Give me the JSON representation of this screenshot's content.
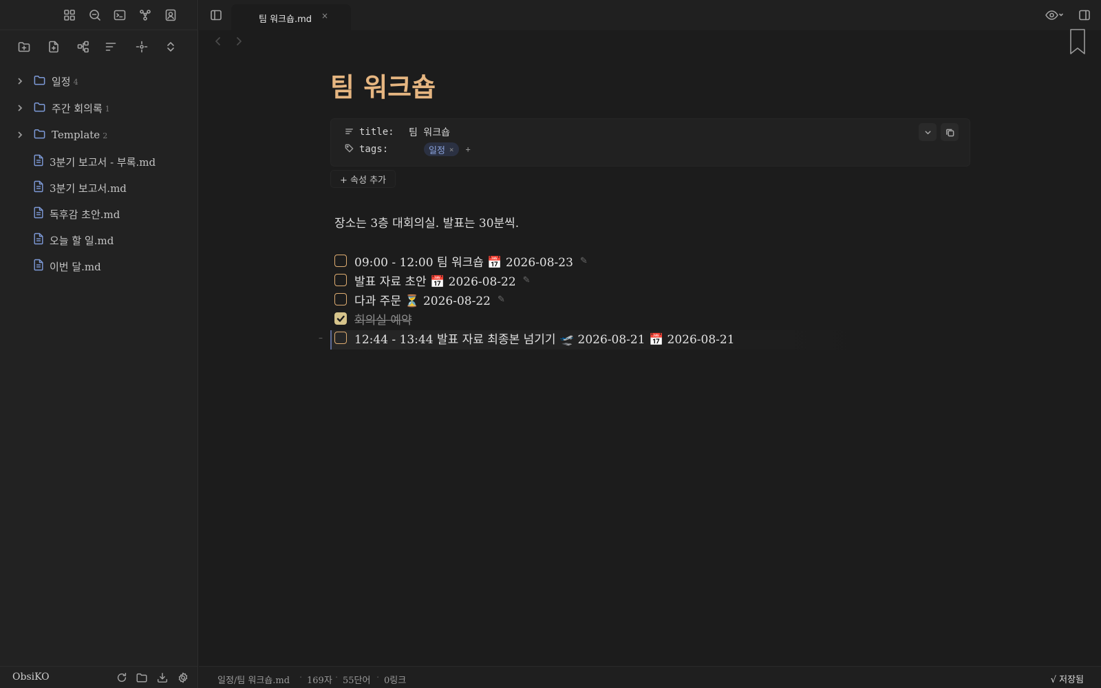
{
  "app": {
    "vault_name": "ObsiKO"
  },
  "sidebar": {
    "tree": [
      {
        "type": "folder",
        "name": "일정",
        "count": "4"
      },
      {
        "type": "folder",
        "name": "주간 회의록",
        "count": "1"
      },
      {
        "type": "folder",
        "name": "Template",
        "count": "2"
      },
      {
        "type": "file",
        "name": "3분기 보고서 - 부록.md"
      },
      {
        "type": "file",
        "name": "3분기 보고서.md"
      },
      {
        "type": "file",
        "name": "독후감 초안.md"
      },
      {
        "type": "file",
        "name": "오늘 할 일.md"
      },
      {
        "type": "file",
        "name": "이번 달.md"
      }
    ]
  },
  "tab": {
    "title": "팀 워크숍.md",
    "close_glyph": "×"
  },
  "note": {
    "title": "팀 워크숍",
    "properties": {
      "title_key": "title:",
      "title_value": "팀 워크숍",
      "tags_key": "tags:",
      "tag": "일정",
      "tag_remove": "×",
      "tag_add": "+"
    },
    "add_property_label": "+ 속성 추가",
    "body": "장소는 3층 대회의실. 발표는 30분씩.",
    "tasks": [
      {
        "text": "09:00 - 12:00 팀 워크숍 📅 2026-08-23",
        "checked": false,
        "edit": "✎"
      },
      {
        "text": "발표 자료 초안 📅 2026-08-22",
        "checked": false,
        "edit": "✎"
      },
      {
        "text": "다과 주문 ⏳ 2026-08-22",
        "checked": false,
        "edit": "✎"
      },
      {
        "text": "회의실 예약",
        "checked": true
      },
      {
        "text": "12:44 - 13:44 발표 자료 최종본 넘기기 🛫 2026-08-21 📅 2026-08-21",
        "checked": false
      }
    ]
  },
  "status_bar": {
    "path": "일정/팀 워크숍.md",
    "chars": "169자",
    "words": "55단어",
    "links": "0링크",
    "saved": "√ 저장됨"
  },
  "colors": {
    "accent_title": "#e6b681",
    "checkbox": "#e0ae72",
    "folder_icon": "#7e9bd9",
    "tag_text": "#8aa2dc"
  }
}
